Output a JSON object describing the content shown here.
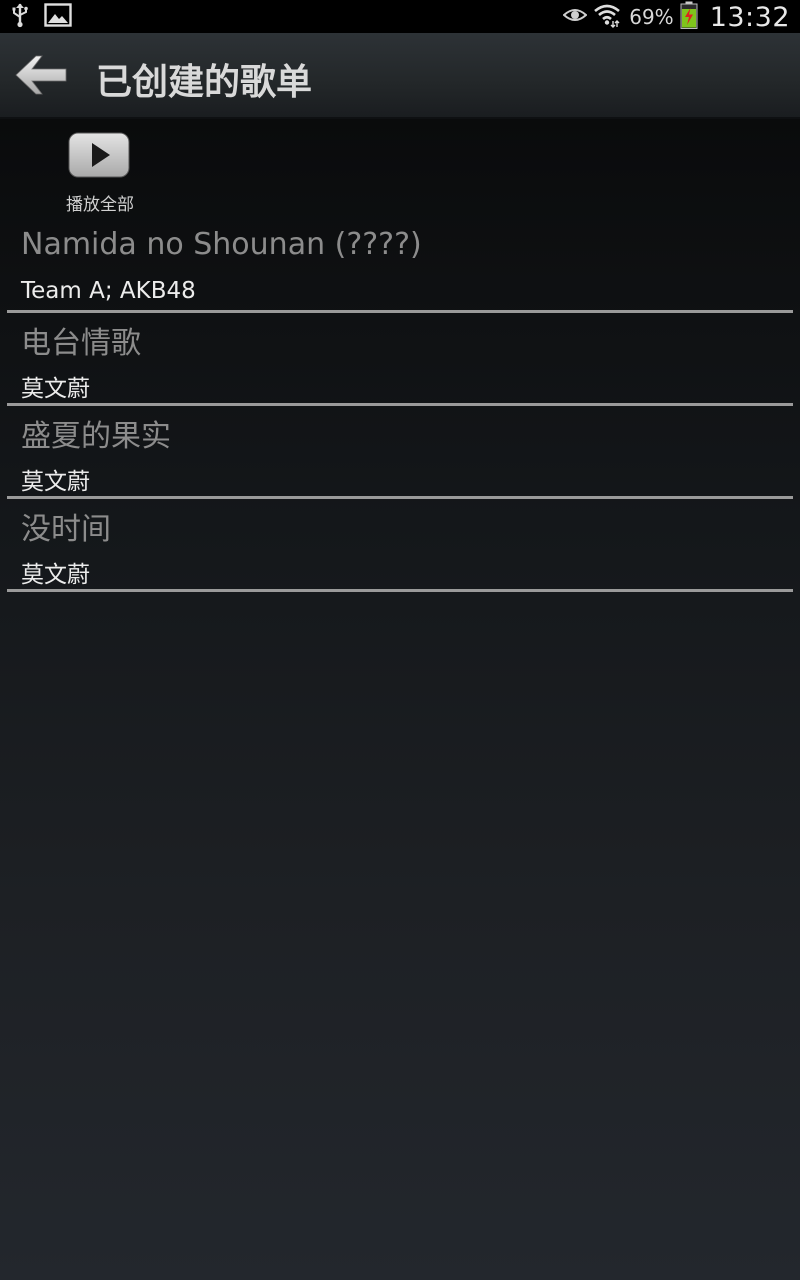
{
  "status_bar": {
    "left_icons": [
      "usb-icon",
      "image-notification-icon"
    ],
    "right_icons": [
      "eye-icon",
      "wifi-icon",
      "battery-charging-icon"
    ],
    "battery_percent": "69%",
    "time": "13:32",
    "colors": {
      "battery_fill": "#7fc41c",
      "battery_bolt": "#e02020"
    }
  },
  "action_bar": {
    "back_icon": "back-arrow-icon",
    "title": "已创建的歌单"
  },
  "play_all": {
    "icon": "play-icon",
    "label": "播放全部"
  },
  "songs": [
    {
      "title": "Namida no Shounan (????)",
      "artist": "Team A; AKB48"
    },
    {
      "title": "电台情歌",
      "artist": "莫文蔚"
    },
    {
      "title": "盛夏的果实",
      "artist": "莫文蔚"
    },
    {
      "title": "没时间",
      "artist": "莫文蔚"
    }
  ]
}
